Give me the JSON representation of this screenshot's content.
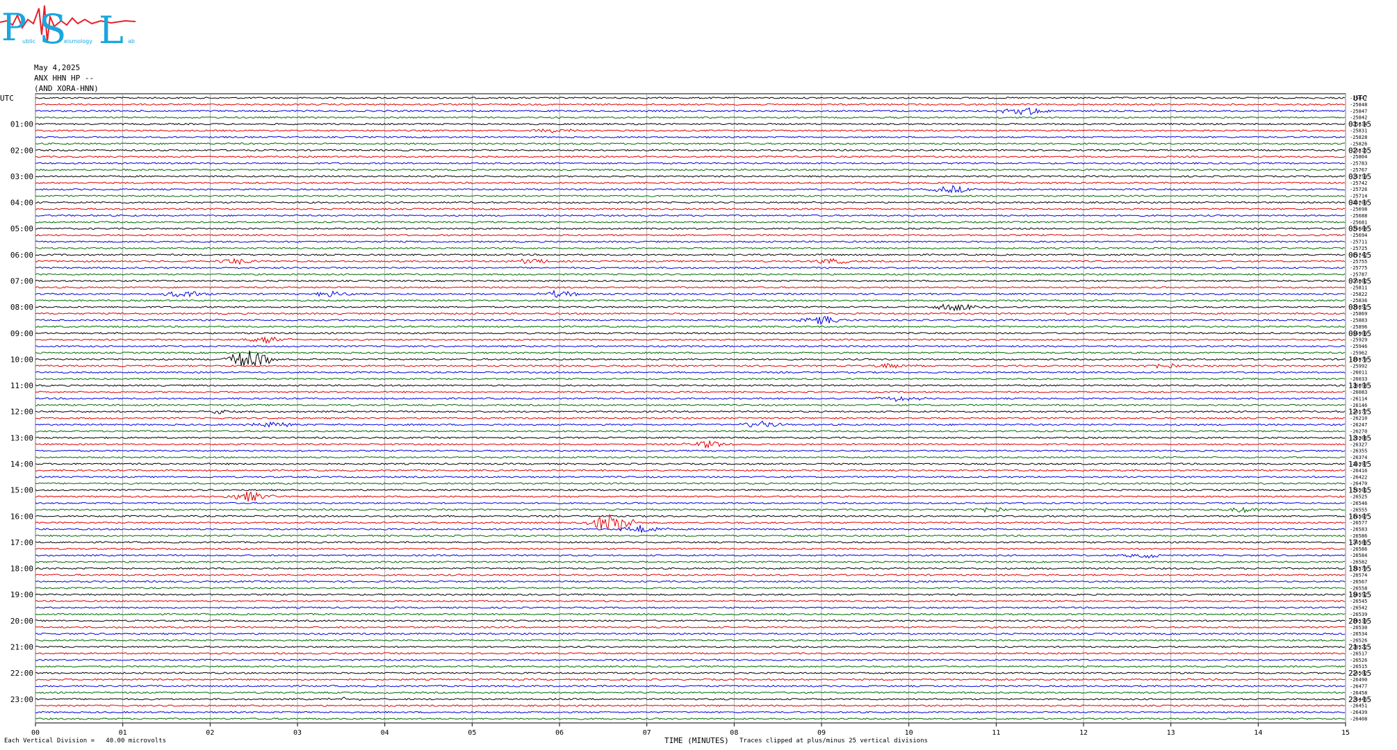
{
  "logo": {
    "big_letters": [
      "P",
      "S",
      "L"
    ],
    "small_words": [
      "ublic",
      "eismology",
      "ab"
    ],
    "colors": {
      "letters": "#1aa6e0",
      "trace": "#e8202a"
    }
  },
  "header": {
    "date": "May 4,2025",
    "channel": "ANX HHN HP --",
    "source": "(AND XORA-HNN)"
  },
  "utc_label_left": "UTC",
  "utc_label_right": "UTC",
  "footer": {
    "scale_note": "Each Vertical Division =   40.00 microvolts",
    "axis_title": "TIME (MINUTES)",
    "clip_note": "Traces clipped at plus/minus 25 vertical divisions"
  },
  "chart_data": {
    "type": "line",
    "title": "",
    "xlabel": "TIME (MINUTES)",
    "ylabel": "UTC",
    "xlim": [
      0,
      15
    ],
    "x_ticks": [
      "00",
      "01",
      "02",
      "03",
      "04",
      "05",
      "06",
      "07",
      "08",
      "09",
      "10",
      "11",
      "12",
      "13",
      "14",
      "15"
    ],
    "vertical_gridlines": true,
    "trace_minutes": 15,
    "trace_count": 96,
    "trace_colors": [
      "#000000",
      "#e00000",
      "#0000e0",
      "#006a00"
    ],
    "left_hour_labels": [
      "01:00",
      "02:00",
      "03:00",
      "04:00",
      "05:00",
      "06:00",
      "07:00",
      "08:00",
      "09:00",
      "10:00",
      "11:00",
      "12:00",
      "13:00",
      "14:00",
      "15:00",
      "16:00",
      "17:00",
      "18:00",
      "19:00",
      "20:00",
      "21:00",
      "22:00",
      "23:00"
    ],
    "right_hour_labels": [
      "01:15",
      "02:15",
      "03:15",
      "04:15",
      "05:15",
      "06:15",
      "07:15",
      "08:15",
      "09:15",
      "10:15",
      "11:15",
      "12:15",
      "13:15",
      "14:15",
      "15:15",
      "16:15",
      "17:15",
      "18:15",
      "19:15",
      "20:15",
      "21:15",
      "22:15",
      "23:15"
    ],
    "trace_offsets": [
      "-25847",
      "-25848",
      "-25847",
      "-25842",
      "-25834",
      "-25831",
      "-25828",
      "-25826",
      "-25815",
      "-25804",
      "-25783",
      "-25767",
      "-25759",
      "-25742",
      "-25726",
      "-25714",
      "-25703",
      "-25698",
      "-25688",
      "-25681",
      "-25684",
      "-25694",
      "-25711",
      "-25725",
      "-25742",
      "-25755",
      "-25775",
      "-25787",
      "-25802",
      "-25811",
      "-25822",
      "-25836",
      "-25852",
      "-25869",
      "-25883",
      "-25896",
      "-25909",
      "-25929",
      "-25946",
      "-25962",
      "-25979",
      "-25992",
      "-26011",
      "-26033",
      "-26058",
      "-26083",
      "-26114",
      "-26146",
      "-26177",
      "-26210",
      "-26247",
      "-26270",
      "-26306",
      "-26327",
      "-26355",
      "-26374",
      "-26397",
      "-26416",
      "-26422",
      "-26470",
      "-26501",
      "-26525",
      "-26546",
      "-26555",
      "-26567",
      "-26577",
      "-26583",
      "-26586",
      "-26586",
      "-26586",
      "-26584",
      "-26582",
      "-26579",
      "-26574",
      "-26567",
      "-26558",
      "-26552",
      "-26545",
      "-26542",
      "-26539",
      "-26539",
      "-26530",
      "-26534",
      "-26526",
      "-26522",
      "-26517",
      "-26526",
      "-26515",
      "-26502",
      "-26490",
      "-26477",
      "-26458",
      "-26445",
      "-26451",
      "-26439",
      "-26408"
    ],
    "events": [
      {
        "trace": 2,
        "minute": 11.3,
        "amp": 7
      },
      {
        "trace": 5,
        "minute": 5.95,
        "amp": 3
      },
      {
        "trace": 14,
        "minute": 10.5,
        "amp": 5
      },
      {
        "trace": 25,
        "minute": 2.3,
        "amp": 4
      },
      {
        "trace": 25,
        "minute": 5.7,
        "amp": 4
      },
      {
        "trace": 25,
        "minute": 9.1,
        "amp": 4
      },
      {
        "trace": 30,
        "minute": 1.7,
        "amp": 5
      },
      {
        "trace": 30,
        "minute": 3.4,
        "amp": 4
      },
      {
        "trace": 30,
        "minute": 6.0,
        "amp": 5
      },
      {
        "trace": 32,
        "minute": 10.55,
        "amp": 6
      },
      {
        "trace": 34,
        "minute": 9.0,
        "amp": 6
      },
      {
        "trace": 37,
        "minute": 2.65,
        "amp": 6
      },
      {
        "trace": 40,
        "minute": 2.45,
        "amp": 14
      },
      {
        "trace": 41,
        "minute": 9.8,
        "amp": 4
      },
      {
        "trace": 41,
        "minute": 12.9,
        "amp": 4
      },
      {
        "trace": 46,
        "minute": 9.9,
        "amp": 4
      },
      {
        "trace": 48,
        "minute": 2.15,
        "amp": 3
      },
      {
        "trace": 50,
        "minute": 8.3,
        "amp": 5
      },
      {
        "trace": 50,
        "minute": 2.7,
        "amp": 4
      },
      {
        "trace": 53,
        "minute": 7.7,
        "amp": 5
      },
      {
        "trace": 61,
        "minute": 2.45,
        "amp": 8
      },
      {
        "trace": 65,
        "minute": 6.6,
        "amp": 14
      },
      {
        "trace": 66,
        "minute": 6.95,
        "amp": 6
      },
      {
        "trace": 63,
        "minute": 10.9,
        "amp": 4
      },
      {
        "trace": 63,
        "minute": 13.8,
        "amp": 4
      },
      {
        "trace": 70,
        "minute": 12.7,
        "amp": 4
      },
      {
        "trace": 92,
        "minute": 3.6,
        "amp": 3
      }
    ]
  }
}
